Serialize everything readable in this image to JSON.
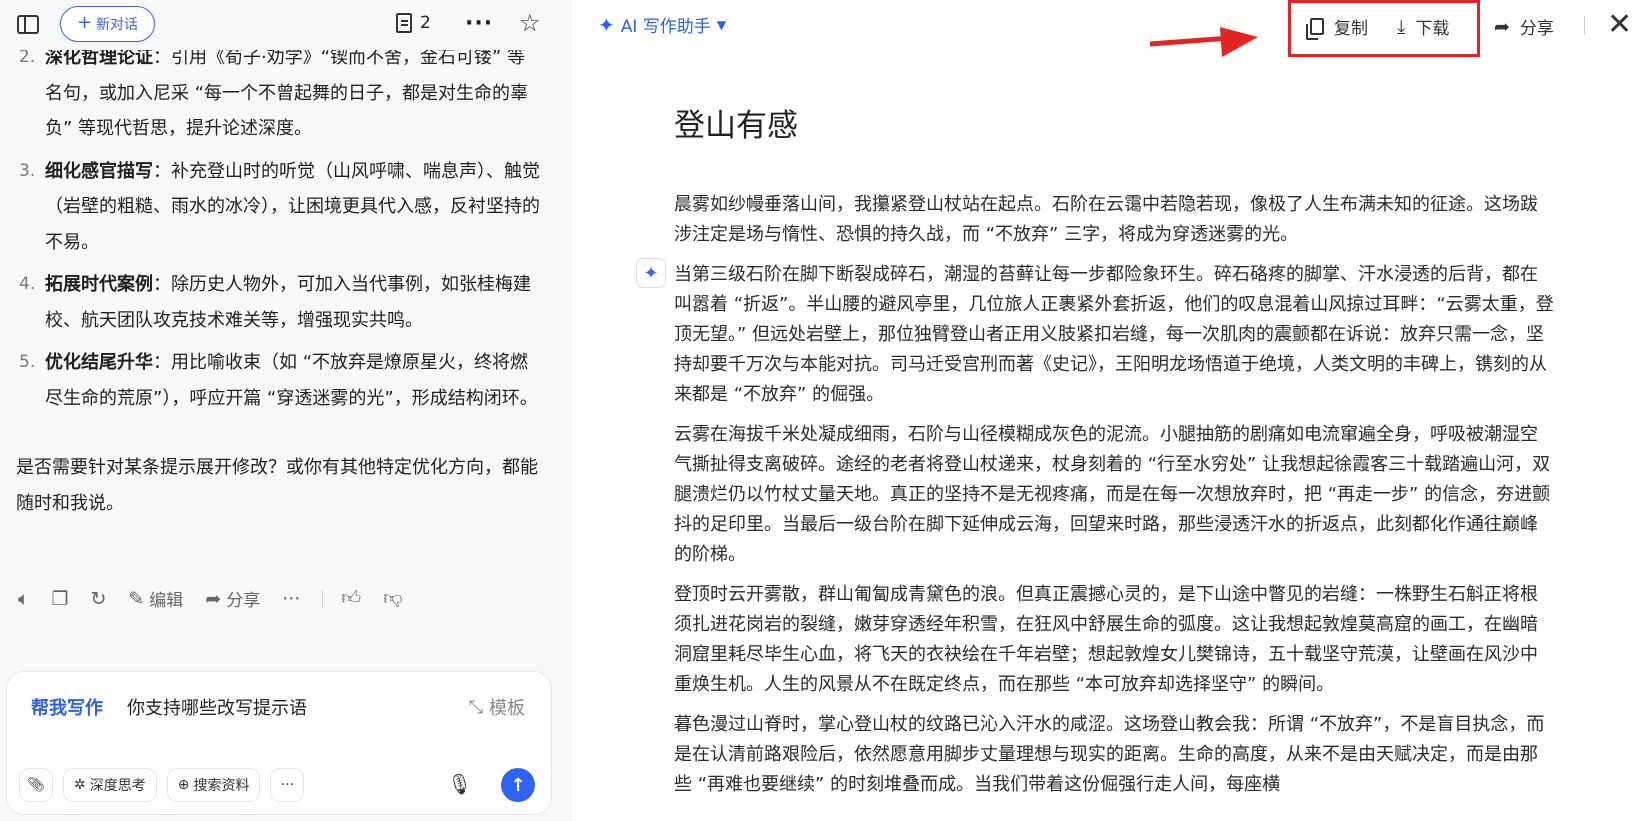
{
  "left_panel": {
    "new_chat_label": "新对话",
    "doc_count": "2",
    "list_items": [
      {
        "num": "2.",
        "title": "深化哲理论证",
        "text": "：引用《荀子·劝学》“锲而不舍，金石可镂” 等名句，或加入尼采 “每一个不曾起舞的日子，都是对生命的辜负” 等现代哲思，提升论述深度。"
      },
      {
        "num": "3.",
        "title": "细化感官描写",
        "text": "：补充登山时的听觉（山风呼啸、喘息声）、触觉（岩壁的粗糙、雨水的冰冷），让困境更具代入感，反衬坚持的不易。"
      },
      {
        "num": "4.",
        "title": "拓展时代案例",
        "text": "：除历史人物外，可加入当代事例，如张桂梅建校、航天团队攻克技术难关等，增强现实共鸣。"
      },
      {
        "num": "5.",
        "title": "优化结尾升华",
        "text": "：用比喻收束（如 “不放弃是燎原星火，终将燃尽生命的荒原”），呼应开篇 “穿透迷雾的光”，形成结构闭环。"
      }
    ],
    "closing": "是否需要针对某条提示展开修改？或你有其他特定优化方向，都能随时和我说。",
    "actions": {
      "edit": "编辑",
      "share": "分享"
    },
    "composer": {
      "mode": "帮我写作",
      "input": "你支持哪些改写提示语",
      "template": "模板",
      "deep_think": "深度思考",
      "search": "搜索资料"
    }
  },
  "right_panel": {
    "assistant_label": "AI 写作助手",
    "copy_label": "复制",
    "download_label": "下载",
    "share_label": "分享",
    "title": "登山有感",
    "paragraphs": [
      "晨雾如纱幔垂落山间，我攥紧登山杖站在起点。石阶在云霭中若隐若现，像极了人生布满未知的征途。这场跋涉注定是场与惰性、恐惧的持久战，而 “不放弃” 三字，将成为穿透迷雾的光。",
      "当第三级石阶在脚下断裂成碎石，潮湿的苔藓让每一步都险象环生。碎石硌疼的脚掌、汗水浸透的后背，都在叫嚣着 “折返”。半山腰的避风亭里，几位旅人正裹紧外套折返，他们的叹息混着山风掠过耳畔：“云雾太重，登顶无望。” 但远处岩壁上，那位独臂登山者正用义肢紧扣岩缝，每一次肌肉的震颤都在诉说：放弃只需一念，坚持却要千万次与本能对抗。司马迁受宫刑而著《史记》，王阳明龙场悟道于绝境，人类文明的丰碑上，镌刻的从来都是 “不放弃” 的倔强。",
      "云雾在海拔千米处凝成细雨，石阶与山径模糊成灰色的泥流。小腿抽筋的剧痛如电流窜遍全身，呼吸被潮湿空气撕扯得支离破碎。途经的老者将登山杖递来，杖身刻着的 “行至水穷处” 让我想起徐霞客三十载踏遍山河，双腿溃烂仍以竹杖丈量天地。真正的坚持不是无视疼痛，而是在每一次想放弃时，把 “再走一步” 的信念，夯进颤抖的足印里。当最后一级台阶在脚下延伸成云海，回望来时路，那些浸透汗水的折返点，此刻都化作通往巅峰的阶梯。",
      "登顶时云开雾散，群山匍匐成青黛色的浪。但真正震撼心灵的，是下山途中瞥见的岩缝：一株野生石斛正将根须扎进花岗岩的裂缝，嫩芽穿透经年积雪，在狂风中舒展生命的弧度。这让我想起敦煌莫高窟的画工，在幽暗洞窟里耗尽毕生心血，将飞天的衣袂绘在千年岩壁；想起敦煌女儿樊锦诗，五十载坚守荒漠，让壁画在风沙中重焕生机。人生的风景从不在既定终点，而在那些 “本可放弃却选择坚守” 的瞬间。",
      "暮色漫过山脊时，掌心登山杖的纹路已沁入汗水的咸涩。这场登山教会我：所谓 “不放弃”，不是盲目执念，而是在认清前路艰险后，依然愿意用脚步丈量理想与现实的距离。生命的高度，从来不是由天赋决定，而是由那些 “再难也要继续” 的时刻堆叠而成。当我们带着这份倔强行走人间，每座横"
    ]
  },
  "colors": {
    "accent": "#2f5fe8",
    "highlight": "#e32424",
    "left_bg": "#f7f8fa"
  }
}
